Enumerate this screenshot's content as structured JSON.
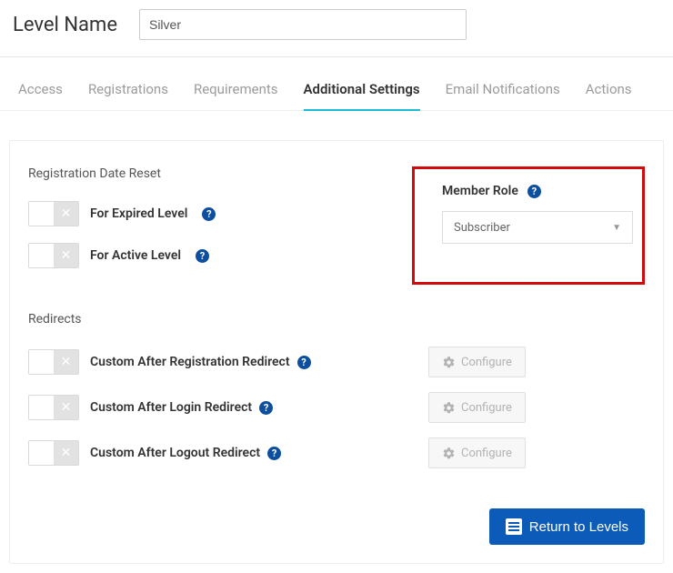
{
  "header": {
    "label": "Level Name",
    "value": "Silver"
  },
  "tabs": [
    {
      "label": "Access",
      "active": false
    },
    {
      "label": "Registrations",
      "active": false
    },
    {
      "label": "Requirements",
      "active": false
    },
    {
      "label": "Additional Settings",
      "active": true
    },
    {
      "label": "Email Notifications",
      "active": false
    },
    {
      "label": "Actions",
      "active": false
    }
  ],
  "registration_reset": {
    "title": "Registration Date Reset",
    "items": [
      {
        "label": "For Expired Level"
      },
      {
        "label": "For Active Level"
      }
    ]
  },
  "member_role": {
    "title": "Member Role",
    "selected": "Subscriber"
  },
  "redirects": {
    "title": "Redirects",
    "items": [
      {
        "label": "Custom After Registration Redirect",
        "button": "Configure"
      },
      {
        "label": "Custom After Login Redirect",
        "button": "Configure"
      },
      {
        "label": "Custom After Logout Redirect",
        "button": "Configure"
      }
    ]
  },
  "footer": {
    "return": "Return to Levels"
  },
  "icons": {
    "close": "✕",
    "help": "?",
    "caret": "▼"
  }
}
